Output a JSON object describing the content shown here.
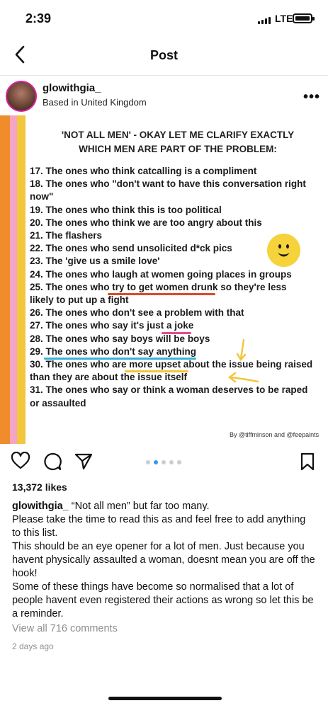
{
  "status": {
    "time": "2:39",
    "network": "LTE"
  },
  "nav": {
    "title": "Post"
  },
  "author": {
    "username": "glowithgia_",
    "location": "Based in United Kingdom"
  },
  "image": {
    "title_line1": "'NOT ALL MEN' - OKAY LET ME CLARIFY EXACTLY",
    "title_line2": "WHICH MEN ARE PART OF THE PROBLEM:",
    "items": [
      "17. The ones who think catcalling is a compliment",
      "18. The ones who \"don't want to have this conversation right now\"",
      "19. The ones who think this is too political",
      "20. The ones who think we are too angry about this",
      "21. The flashers",
      "22. The ones who send unsolicited d*ck pics",
      "23. The 'give us a smile love'",
      "24. The ones who laugh at women going places in groups",
      "25. The ones who try to get women drunk so they're less likely to put up a fight",
      "26. The ones who don't see a problem with that",
      "27. The ones who say it's just a joke",
      "28. The ones who say boys will be boys",
      "29. The ones who don't say anything",
      "30. The ones who are more upset about the issue being raised than they are about the issue itself",
      "31. The ones who say or think a woman deserves to be raped or assaulted"
    ],
    "credit": "By @tiffminson and @feepaints"
  },
  "carousel": {
    "count": 5,
    "active": 1
  },
  "likes": "13,372 likes",
  "caption": {
    "username": "glowithgia_",
    "text": "“Not all men” but far too many.",
    "p1": "Please take the time to read this as and feel free to add anything to this list.",
    "p2": "This should be an eye opener for a lot of men. Just because you havent physically assaulted a woman, doesnt mean you are off the hook!",
    "p3": "Some of these things have become so normalised that a lot of people havent even registered their actions as wrong so let this be a reminder."
  },
  "comments_link": "View all 716 comments",
  "timestamp": "2 days ago"
}
